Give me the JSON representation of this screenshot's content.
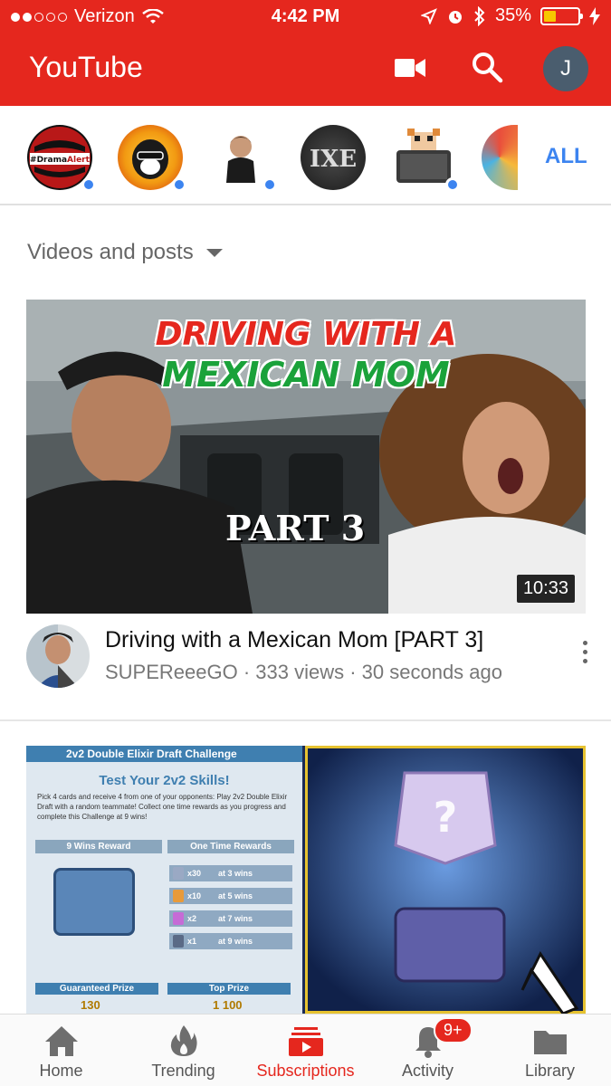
{
  "status_bar": {
    "carrier": "Verizon",
    "time": "4:42 PM",
    "battery": "35%",
    "battery_level": 0.35,
    "signal_bars": 2
  },
  "app_bar": {
    "title": "YouTube",
    "upload_icon": "video-camera-icon",
    "search_icon": "search-icon",
    "account_initial": "J"
  },
  "channels": {
    "items": [
      {
        "label": "#Drama Alert",
        "has_new": true
      },
      {
        "label": "",
        "has_new": true
      },
      {
        "label": "",
        "has_new": true
      },
      {
        "label": "",
        "has_new": false
      },
      {
        "label": "",
        "has_new": true
      },
      {
        "label": "",
        "has_new": false
      }
    ],
    "all_label": "ALL"
  },
  "filter": {
    "label": "Videos and posts"
  },
  "videos": [
    {
      "thumb_title_line1": "DRIVING WITH A",
      "thumb_title_line2": "MEXICAN MOM",
      "thumb_subtitle": "PART 3",
      "duration": "10:33",
      "title": "Driving with a Mexican Mom [PART 3]",
      "channel": "SUPEReeeGO",
      "views": "333 views",
      "age": "30 seconds ago",
      "subtitle": "SUPEReeeGO · 333 views · 30 seconds ago"
    },
    {
      "thumb_header": "2v2 Double Elixir Draft Challenge",
      "thumb_heading": "Test Your 2v2 Skills!",
      "thumb_body": "Pick 4 cards and receive 4 from one of your opponents: Play 2v2 Double Elixir Draft with a random teammate! Collect one time rewards as you progress and complete this Challenge at 9 wins!",
      "wins_reward": "9 Wins Reward",
      "one_time_rewards": "One Time Rewards",
      "rewards": [
        {
          "qty": "x30",
          "at": "at 3 wins"
        },
        {
          "qty": "x10",
          "at": "at 5 wins"
        },
        {
          "qty": "x2",
          "at": "at 7 wins"
        },
        {
          "qty": "x1",
          "at": "at 9 wins"
        }
      ],
      "guaranteed_prize": "Guaranteed Prize",
      "guaranteed_value": "130",
      "top_prize": "Top Prize",
      "top_value": "1 100"
    }
  ],
  "bottom_nav": [
    {
      "label": "Home",
      "icon": "home-icon",
      "active": false
    },
    {
      "label": "Trending",
      "icon": "flame-icon",
      "active": false
    },
    {
      "label": "Subscriptions",
      "icon": "subscriptions-icon",
      "active": true
    },
    {
      "label": "Activity",
      "icon": "bell-icon",
      "active": false,
      "badge": "9+"
    },
    {
      "label": "Library",
      "icon": "folder-icon",
      "active": false
    }
  ],
  "colors": {
    "brand_red": "#e5271e",
    "link_blue": "#3c84f0"
  }
}
